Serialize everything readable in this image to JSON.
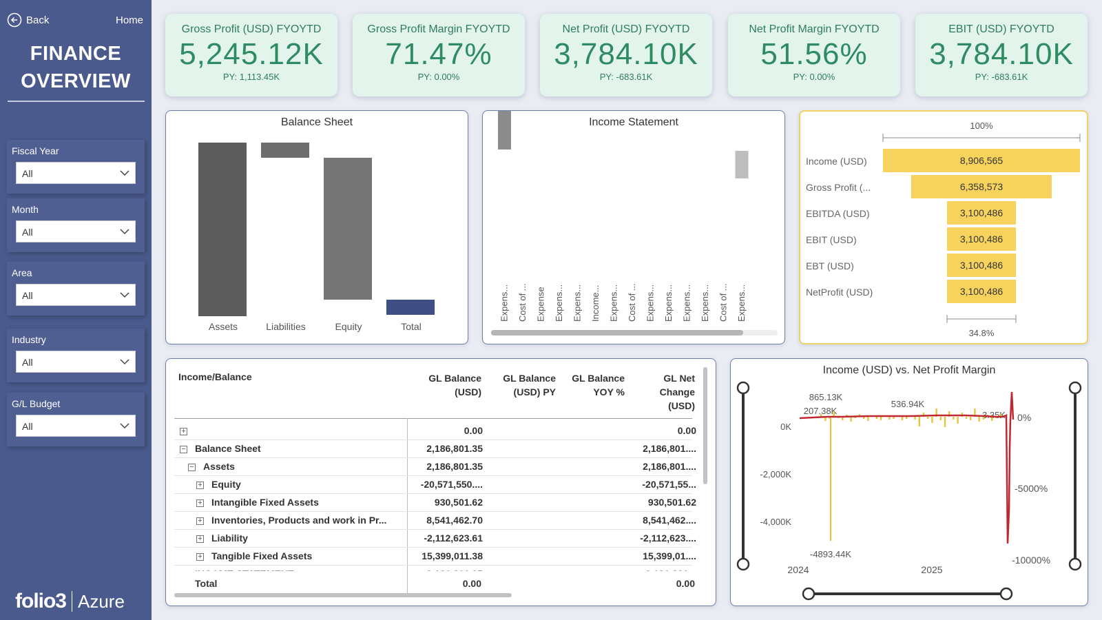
{
  "nav": {
    "back_label": "Back",
    "home_label": "Home"
  },
  "app_title_line1": "FINANCE",
  "app_title_line2": "OVERVIEW",
  "filters": [
    {
      "label": "Fiscal Year",
      "value": "All"
    },
    {
      "label": "Month",
      "value": "All"
    },
    {
      "label": "Area",
      "value": "All"
    },
    {
      "label": "Industry",
      "value": "All"
    },
    {
      "label": "G/L Budget",
      "value": "All"
    }
  ],
  "brand": {
    "logo": "folio3",
    "azure": "Azure"
  },
  "colors": {
    "sidebar": "#4a5a8c",
    "kpi_bg": "#e2f4ec",
    "kpi_text": "#2e8b62",
    "funnel": "#f7d25d",
    "waterfall_dark": "#5a5a5a",
    "waterfall_total": "#3f4f86",
    "line_red": "#c0282f",
    "bar_yellow": "#e8c33a"
  },
  "kpis": [
    {
      "title": "Gross Profit (USD) FYOYTD",
      "value": "5,245.12K",
      "py": "PY: 1,113.45K"
    },
    {
      "title": "Gross Profit Margin FYOYTD",
      "value": "71.47%",
      "py": "PY: 0.00%"
    },
    {
      "title": "Net Profit (USD) FYOYTD",
      "value": "3,784.10K",
      "py": "PY: -683.61K"
    },
    {
      "title": "Net Profit Margin FYOYTD",
      "value": "51.56%",
      "py": "PY: 0.00%"
    },
    {
      "title": "EBIT (USD) FYOYTD",
      "value": "3,784.10K",
      "py": "PY: -683.61K"
    }
  ],
  "balance_sheet": {
    "title": "Balance Sheet",
    "categories": [
      "Assets",
      "Liabilities",
      "Equity",
      "Total"
    ]
  },
  "income_statement": {
    "title": "Income Statement",
    "categories": [
      "Expens...",
      "Cost of ...",
      "Expense",
      "Expens...",
      "Expens...",
      "Income...",
      "Expens...",
      "Cost of ...",
      "Expens...",
      "Expens...",
      "Expens...",
      "Expens...",
      "Cost of ...",
      "Expens..."
    ]
  },
  "funnel": {
    "top_label": "100%",
    "bottom_label": "34.8%",
    "rows": [
      {
        "label": "Income (USD)",
        "value": "8,906,565",
        "num": 8906565
      },
      {
        "label": "Gross Profit (...",
        "value": "6,358,573",
        "num": 6358573
      },
      {
        "label": "EBITDA (USD)",
        "value": "3,100,486",
        "num": 3100486
      },
      {
        "label": "EBIT (USD)",
        "value": "3,100,486",
        "num": 3100486
      },
      {
        "label": "EBT (USD)",
        "value": "3,100,486",
        "num": 3100486
      },
      {
        "label": "NetProfit (USD)",
        "value": "3,100,486",
        "num": 3100486
      }
    ]
  },
  "table": {
    "headers": {
      "c0": "Income/Balance",
      "c1a": "GL Balance",
      "c1b": "(USD)",
      "c2a": "GL Balance",
      "c2b": "(USD) PY",
      "c3a": "GL Balance",
      "c3b": "YOY %",
      "c4a": "GL Net",
      "c4b": "Change",
      "c4c": "(USD)"
    },
    "rows": [
      {
        "label": "",
        "balance": "0.00",
        "change": "0.00",
        "indent": 0,
        "sign": "+"
      },
      {
        "label": "Balance Sheet",
        "balance": "2,186,801.35",
        "change": "2,186,801....",
        "indent": 0,
        "sign": "−"
      },
      {
        "label": "Assets",
        "balance": "2,186,801.35",
        "change": "2,186,801....",
        "indent": 1,
        "sign": "−"
      },
      {
        "label": "Equity",
        "balance": "-20,571,550....",
        "change": "-20,571,55...",
        "indent": 2,
        "sign": "+"
      },
      {
        "label": "Intangible Fixed Assets",
        "balance": "930,501.62",
        "change": "930,501.62",
        "indent": 2,
        "sign": "+"
      },
      {
        "label": "Inventories, Products and work in Pr...",
        "balance": "8,541,462.70",
        "change": "8,541,462....",
        "indent": 2,
        "sign": "+"
      },
      {
        "label": "Liability",
        "balance": "-2,112,623.61",
        "change": "-2,112,623....",
        "indent": 2,
        "sign": "+"
      },
      {
        "label": "Tangible Fixed Assets",
        "balance": "15,399,011.38",
        "change": "15,399,01....",
        "indent": 2,
        "sign": "+"
      },
      {
        "label": "INCOME STATEMENT",
        "balance": "2,186,801.35",
        "change": "2,186,801...",
        "indent": 0,
        "sign": "−"
      }
    ],
    "total": {
      "label": "Total",
      "balance": "0.00",
      "change": "0.00"
    }
  },
  "combo": {
    "title": "Income (USD) vs. Net Profit Margin",
    "y_left_ticks": [
      "0K",
      "-2,000K",
      "-4,000K"
    ],
    "y_right_ticks": [
      "0%",
      "-5000%",
      "-10000%"
    ],
    "x_ticks": [
      "2024",
      "2025"
    ],
    "annotations": [
      "865.13K",
      "207.38K",
      "536.94K",
      "3.35K",
      "-4893.44K"
    ]
  },
  "chart_data": [
    {
      "type": "bar",
      "title": "Balance Sheet",
      "subtype": "waterfall",
      "categories": [
        "Assets",
        "Liabilities",
        "Equity",
        "Total"
      ],
      "values": [
        2186801.35,
        -2112623.61,
        -20571550,
        0
      ]
    },
    {
      "type": "bar",
      "title": "Income Statement",
      "subtype": "waterfall",
      "categories": [
        "Expens...",
        "Cost of ...",
        "Expense",
        "Expens...",
        "Expens...",
        "Income...",
        "Expens...",
        "Cost of ...",
        "Expens...",
        "Expens...",
        "Expens...",
        "Expens...",
        "Cost of ...",
        "Expens..."
      ],
      "values": [
        -57,
        -33,
        -12,
        -9,
        -4,
        -3,
        -2,
        -1,
        -0.5,
        -0.3,
        -0.2,
        -0.1,
        -0.1,
        40
      ]
    },
    {
      "type": "bar",
      "subtype": "funnel",
      "categories": [
        "Income (USD)",
        "Gross Profit (...",
        "EBITDA (USD)",
        "EBIT (USD)",
        "EBT (USD)",
        "NetProfit (USD)"
      ],
      "values": [
        8906565,
        6358573,
        3100486,
        3100486,
        3100486,
        3100486
      ]
    },
    {
      "type": "line",
      "title": "Income (USD) vs. Net Profit Margin",
      "x": [
        "2024",
        "2025"
      ],
      "series": [
        {
          "name": "Income (USD)",
          "values": [
            865.13,
            207.38,
            536.94,
            3.35,
            -4893.44
          ]
        },
        {
          "name": "Net Profit Margin",
          "values": [
            0,
            0,
            -10000
          ]
        }
      ],
      "ylim_left": [
        -4893.44,
        865.13
      ],
      "ylim_right": [
        -10000,
        0
      ]
    }
  ]
}
